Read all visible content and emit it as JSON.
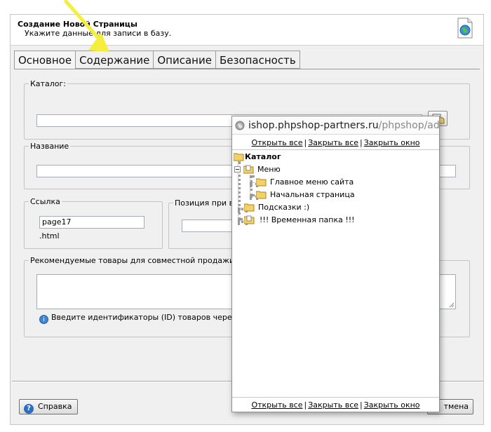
{
  "header": {
    "title": "Создание Новой Страницы",
    "subtitle": "Укажите данные для записи в базу."
  },
  "tabs": [
    {
      "label": "Основное",
      "active": true
    },
    {
      "label": "Содержание",
      "active": false
    },
    {
      "label": "Описание",
      "active": false
    },
    {
      "label": "Безопасность",
      "active": false
    }
  ],
  "form": {
    "catalog_label": "Каталог:",
    "catalog_value": "",
    "name_label": "Название",
    "name_value": "",
    "link_label": "Ссылка",
    "link_value": "page17",
    "link_suffix": ".html",
    "position_label": "Позиция при вы",
    "position_value": "",
    "recommended_label": "Рекомендуемые товары для совместной продажи:",
    "recommended_value": "",
    "recommended_hint": "Введите идентификаторы (ID) товаров через запят"
  },
  "footer": {
    "help_label": "Справка",
    "cancel_label": "тмена"
  },
  "popup": {
    "url_host": "ishop.phpshop-partners.ru",
    "url_path": "/phpshop/adm",
    "links": [
      "Открыть все",
      "Закрыть все",
      "Закрыть окно"
    ],
    "tree": {
      "root": "Каталог",
      "items": [
        {
          "label": "Меню",
          "level": 1
        },
        {
          "label": "Главное меню сайта",
          "level": 2
        },
        {
          "label": "Начальная страница",
          "level": 2
        },
        {
          "label": "Подсказки :)",
          "level": 1
        },
        {
          "label": "!!! Временная папка !!!",
          "level": 1
        }
      ]
    }
  },
  "colors": {
    "highlight_arrow": "#f6ee3c",
    "folder": "#f2d266",
    "help_blue": "#2a6fc2"
  }
}
